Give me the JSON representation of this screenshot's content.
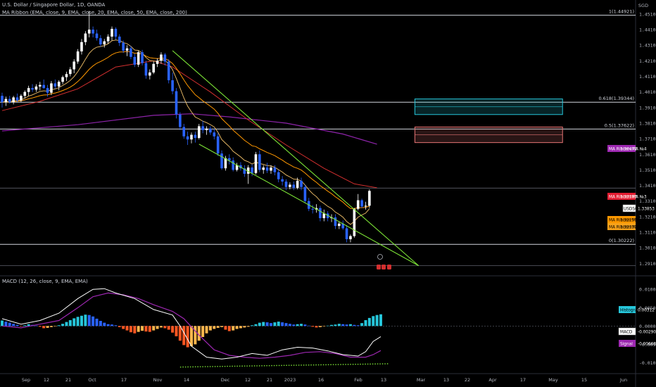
{
  "header": {
    "title": "U.S. Dollar / Singapore Dollar, 1D, OANDA",
    "ma_ribbon": "MA Ribbon (EMA, close, 9, EMA, close, 20, EMA, close, 50, EMA, close, 200)",
    "macd_title": "MACD (12, 26, close, 9, EMA, EMA)"
  },
  "currency_label": "SGD",
  "chart_data": {
    "type": "candlestick",
    "symbol": "USDSGD",
    "price_axis": {
      "ylim": [
        1.282,
        1.459
      ],
      "ticks": [
        1.29,
        1.3,
        1.31,
        1.32,
        1.33,
        1.34,
        1.35,
        1.36,
        1.37,
        1.38,
        1.39,
        1.4,
        1.41,
        1.42,
        1.43,
        1.44,
        1.45
      ],
      "tick_labels": [
        "1.29100",
        "1.30100",
        "1.31100",
        "1.32100",
        "1.33100",
        "1.34100",
        "1.35100",
        "1.36100",
        "1.37100",
        "1.38100",
        "1.39100",
        "1.40100",
        "1.41100",
        "1.42100",
        "1.43100",
        "1.44100",
        "1.45100"
      ]
    },
    "time_axis": {
      "labels": [
        "Sep",
        "12",
        "21",
        "Oct",
        "17",
        "Nov",
        "14",
        "Dec",
        "12",
        "21",
        "2023",
        "16",
        "Feb",
        "13",
        "Mar",
        "13",
        "22",
        "Apr",
        "17",
        "May",
        "15",
        "Jun"
      ]
    },
    "candles": [
      {
        "o": 1.3975,
        "h": 1.3995,
        "l": 1.39,
        "c": 1.3935
      },
      {
        "o": 1.3935,
        "h": 1.397,
        "l": 1.391,
        "c": 1.3955
      },
      {
        "o": 1.3955,
        "h": 1.3975,
        "l": 1.3925,
        "c": 1.3935
      },
      {
        "o": 1.3935,
        "h": 1.3975,
        "l": 1.392,
        "c": 1.3965
      },
      {
        "o": 1.3965,
        "h": 1.399,
        "l": 1.3935,
        "c": 1.3945
      },
      {
        "o": 1.3945,
        "h": 1.3985,
        "l": 1.3935,
        "c": 1.3975
      },
      {
        "o": 1.3975,
        "h": 1.401,
        "l": 1.396,
        "c": 1.4
      },
      {
        "o": 1.4,
        "h": 1.404,
        "l": 1.3975,
        "c": 1.4025
      },
      {
        "o": 1.4025,
        "h": 1.405,
        "l": 1.4,
        "c": 1.4015
      },
      {
        "o": 1.4015,
        "h": 1.405,
        "l": 1.4,
        "c": 1.4035
      },
      {
        "o": 1.4035,
        "h": 1.4065,
        "l": 1.401,
        "c": 1.4045
      },
      {
        "o": 1.4045,
        "h": 1.408,
        "l": 1.402,
        "c": 1.4025
      },
      {
        "o": 1.4025,
        "h": 1.4045,
        "l": 1.397,
        "c": 1.3995
      },
      {
        "o": 1.3995,
        "h": 1.407,
        "l": 1.398,
        "c": 1.4055
      },
      {
        "o": 1.4055,
        "h": 1.408,
        "l": 1.402,
        "c": 1.4035
      },
      {
        "o": 1.4035,
        "h": 1.4075,
        "l": 1.401,
        "c": 1.4065
      },
      {
        "o": 1.4065,
        "h": 1.4105,
        "l": 1.405,
        "c": 1.4095
      },
      {
        "o": 1.4095,
        "h": 1.413,
        "l": 1.407,
        "c": 1.4115
      },
      {
        "o": 1.4115,
        "h": 1.416,
        "l": 1.41,
        "c": 1.4145
      },
      {
        "o": 1.4145,
        "h": 1.421,
        "l": 1.412,
        "c": 1.4195
      },
      {
        "o": 1.4195,
        "h": 1.4275,
        "l": 1.418,
        "c": 1.426
      },
      {
        "o": 1.426,
        "h": 1.434,
        "l": 1.424,
        "c": 1.432
      },
      {
        "o": 1.432,
        "h": 1.439,
        "l": 1.43,
        "c": 1.4375
      },
      {
        "o": 1.4375,
        "h": 1.452,
        "l": 1.435,
        "c": 1.44
      },
      {
        "o": 1.44,
        "h": 1.442,
        "l": 1.435,
        "c": 1.4375
      },
      {
        "o": 1.4375,
        "h": 1.44,
        "l": 1.433,
        "c": 1.4345
      },
      {
        "o": 1.4345,
        "h": 1.4365,
        "l": 1.429,
        "c": 1.4305
      },
      {
        "o": 1.4305,
        "h": 1.434,
        "l": 1.4285,
        "c": 1.4325
      },
      {
        "o": 1.4325,
        "h": 1.437,
        "l": 1.431,
        "c": 1.4355
      },
      {
        "o": 1.4355,
        "h": 1.442,
        "l": 1.433,
        "c": 1.4405
      },
      {
        "o": 1.4405,
        "h": 1.4415,
        "l": 1.4335,
        "c": 1.4355
      },
      {
        "o": 1.4355,
        "h": 1.437,
        "l": 1.4295,
        "c": 1.4315
      },
      {
        "o": 1.4315,
        "h": 1.433,
        "l": 1.425,
        "c": 1.4265
      },
      {
        "o": 1.4265,
        "h": 1.43,
        "l": 1.423,
        "c": 1.428
      },
      {
        "o": 1.428,
        "h": 1.4295,
        "l": 1.421,
        "c": 1.4225
      },
      {
        "o": 1.4225,
        "h": 1.4245,
        "l": 1.416,
        "c": 1.4175
      },
      {
        "o": 1.4175,
        "h": 1.4265,
        "l": 1.416,
        "c": 1.4255
      },
      {
        "o": 1.4255,
        "h": 1.427,
        "l": 1.417,
        "c": 1.4185
      },
      {
        "o": 1.4185,
        "h": 1.42,
        "l": 1.4085,
        "c": 1.4105
      },
      {
        "o": 1.4105,
        "h": 1.4145,
        "l": 1.408,
        "c": 1.4125
      },
      {
        "o": 1.4125,
        "h": 1.4195,
        "l": 1.4115,
        "c": 1.418
      },
      {
        "o": 1.418,
        "h": 1.4215,
        "l": 1.416,
        "c": 1.42
      },
      {
        "o": 1.42,
        "h": 1.4255,
        "l": 1.418,
        "c": 1.424
      },
      {
        "o": 1.424,
        "h": 1.425,
        "l": 1.417,
        "c": 1.4195
      },
      {
        "o": 1.4195,
        "h": 1.421,
        "l": 1.4055,
        "c": 1.4075
      },
      {
        "o": 1.4075,
        "h": 1.4125,
        "l": 1.3985,
        "c": 1.4005
      },
      {
        "o": 1.4005,
        "h": 1.4025,
        "l": 1.383,
        "c": 1.3855
      },
      {
        "o": 1.3855,
        "h": 1.387,
        "l": 1.3755,
        "c": 1.3775
      },
      {
        "o": 1.3775,
        "h": 1.3795,
        "l": 1.37,
        "c": 1.3715
      },
      {
        "o": 1.3715,
        "h": 1.3745,
        "l": 1.366,
        "c": 1.3695
      },
      {
        "o": 1.3695,
        "h": 1.374,
        "l": 1.367,
        "c": 1.3725
      },
      {
        "o": 1.3725,
        "h": 1.3745,
        "l": 1.3675,
        "c": 1.3705
      },
      {
        "o": 1.3705,
        "h": 1.3795,
        "l": 1.3695,
        "c": 1.378
      },
      {
        "o": 1.378,
        "h": 1.3815,
        "l": 1.3735,
        "c": 1.3755
      },
      {
        "o": 1.3755,
        "h": 1.378,
        "l": 1.3725,
        "c": 1.3765
      },
      {
        "o": 1.3765,
        "h": 1.378,
        "l": 1.3725,
        "c": 1.374
      },
      {
        "o": 1.374,
        "h": 1.3765,
        "l": 1.3695,
        "c": 1.3715
      },
      {
        "o": 1.3715,
        "h": 1.3735,
        "l": 1.359,
        "c": 1.3605
      },
      {
        "o": 1.3605,
        "h": 1.3625,
        "l": 1.35,
        "c": 1.351
      },
      {
        "o": 1.351,
        "h": 1.359,
        "l": 1.3495,
        "c": 1.3575
      },
      {
        "o": 1.3575,
        "h": 1.36,
        "l": 1.3535,
        "c": 1.356
      },
      {
        "o": 1.356,
        "h": 1.358,
        "l": 1.349,
        "c": 1.35
      },
      {
        "o": 1.35,
        "h": 1.3545,
        "l": 1.349,
        "c": 1.353
      },
      {
        "o": 1.353,
        "h": 1.355,
        "l": 1.3495,
        "c": 1.351
      },
      {
        "o": 1.351,
        "h": 1.353,
        "l": 1.3455,
        "c": 1.3475
      },
      {
        "o": 1.3475,
        "h": 1.353,
        "l": 1.341,
        "c": 1.3515
      },
      {
        "o": 1.3515,
        "h": 1.3535,
        "l": 1.346,
        "c": 1.348
      },
      {
        "o": 1.348,
        "h": 1.3615,
        "l": 1.347,
        "c": 1.36
      },
      {
        "o": 1.36,
        "h": 1.3625,
        "l": 1.3485,
        "c": 1.35
      },
      {
        "o": 1.35,
        "h": 1.353,
        "l": 1.3475,
        "c": 1.3515
      },
      {
        "o": 1.3515,
        "h": 1.3545,
        "l": 1.348,
        "c": 1.3495
      },
      {
        "o": 1.3495,
        "h": 1.353,
        "l": 1.3475,
        "c": 1.3515
      },
      {
        "o": 1.3515,
        "h": 1.353,
        "l": 1.3465,
        "c": 1.3485
      },
      {
        "o": 1.3485,
        "h": 1.35,
        "l": 1.342,
        "c": 1.344
      },
      {
        "o": 1.344,
        "h": 1.346,
        "l": 1.34,
        "c": 1.3425
      },
      {
        "o": 1.3425,
        "h": 1.344,
        "l": 1.337,
        "c": 1.339
      },
      {
        "o": 1.339,
        "h": 1.342,
        "l": 1.3375,
        "c": 1.3405
      },
      {
        "o": 1.3405,
        "h": 1.3425,
        "l": 1.337,
        "c": 1.3385
      },
      {
        "o": 1.3385,
        "h": 1.345,
        "l": 1.3375,
        "c": 1.343
      },
      {
        "o": 1.343,
        "h": 1.345,
        "l": 1.337,
        "c": 1.339
      },
      {
        "o": 1.339,
        "h": 1.3405,
        "l": 1.329,
        "c": 1.33
      },
      {
        "o": 1.33,
        "h": 1.332,
        "l": 1.3235,
        "c": 1.325
      },
      {
        "o": 1.325,
        "h": 1.3275,
        "l": 1.322,
        "c": 1.3245
      },
      {
        "o": 1.3245,
        "h": 1.328,
        "l": 1.3225,
        "c": 1.3255
      },
      {
        "o": 1.3255,
        "h": 1.327,
        "l": 1.317,
        "c": 1.319
      },
      {
        "o": 1.319,
        "h": 1.3245,
        "l": 1.317,
        "c": 1.322
      },
      {
        "o": 1.322,
        "h": 1.3235,
        "l": 1.317,
        "c": 1.319
      },
      {
        "o": 1.319,
        "h": 1.3215,
        "l": 1.3165,
        "c": 1.3195
      },
      {
        "o": 1.3195,
        "h": 1.3215,
        "l": 1.312,
        "c": 1.314
      },
      {
        "o": 1.314,
        "h": 1.317,
        "l": 1.312,
        "c": 1.3155
      },
      {
        "o": 1.3155,
        "h": 1.3175,
        "l": 1.3115,
        "c": 1.3125
      },
      {
        "o": 1.3125,
        "h": 1.3145,
        "l": 1.3035,
        "c": 1.3055
      },
      {
        "o": 1.3055,
        "h": 1.3085,
        "l": 1.3035,
        "c": 1.3075
      },
      {
        "o": 1.3075,
        "h": 1.3255,
        "l": 1.3065,
        "c": 1.325
      },
      {
        "o": 1.325,
        "h": 1.3345,
        "l": 1.324,
        "c": 1.3305
      },
      {
        "o": 1.3305,
        "h": 1.3315,
        "l": 1.3255,
        "c": 1.3265
      },
      {
        "o": 1.3265,
        "h": 1.3295,
        "l": 1.3245,
        "c": 1.327
      },
      {
        "o": 1.327,
        "h": 1.3375,
        "l": 1.3255,
        "c": 1.3365
      }
    ],
    "ma_ribbon": {
      "series": [
        {
          "name": "MA Ribbon:MA №1",
          "color": "#f7a21b",
          "value_label": "1.32332"
        },
        {
          "name": "MA Ribbon:MA №2",
          "color": "#ff9800",
          "value_label": "1.32259"
        },
        {
          "name": "MA Ribbon:MA №3",
          "color": "#e31c31",
          "value_label": "1.33383"
        },
        {
          "name": "MA Ribbon:MA №4",
          "color": "#9c27b0",
          "value_label": "1.36472"
        }
      ],
      "ema200_points": [
        [
          0,
          1.375
        ],
        [
          20,
          1.379
        ],
        [
          40,
          1.385
        ],
        [
          50,
          1.386
        ],
        [
          60,
          1.384
        ],
        [
          75,
          1.38
        ],
        [
          90,
          1.373
        ],
        [
          99,
          1.3665
        ]
      ],
      "ema50_points": [
        [
          0,
          1.388
        ],
        [
          10,
          1.394
        ],
        [
          20,
          1.402
        ],
        [
          30,
          1.416
        ],
        [
          40,
          1.42
        ],
        [
          45,
          1.416
        ],
        [
          55,
          1.4
        ],
        [
          65,
          1.382
        ],
        [
          75,
          1.366
        ],
        [
          85,
          1.351
        ],
        [
          93,
          1.341
        ],
        [
          99,
          1.3385
        ]
      ]
    },
    "price_label": {
      "name": "USDSGD",
      "value": "1.33853"
    },
    "top_label": "1(1.44921)",
    "fib_levels": [
      {
        "label": "1(1.44921)",
        "value": 1.44921
      },
      {
        "label": "0.618(1.39344)",
        "value": 1.39344
      },
      {
        "label": "0.5(1.37622)",
        "value": 1.37622
      },
      {
        "label": "0(1.30222)",
        "value": 1.30222
      }
    ],
    "extra_levels": [
      1.3383,
      1.2885
    ],
    "zones": [
      {
        "name": "cyan-zone",
        "top": 1.3955,
        "bottom": 1.3855,
        "start_bar": 109,
        "end_bar": 148,
        "color": "#26c6da"
      },
      {
        "name": "red-zone",
        "top": 1.3775,
        "bottom": 1.3675,
        "start_bar": 109,
        "end_bar": 148,
        "color": "#e57373"
      }
    ],
    "trendlines": [
      {
        "name": "upper-wedge-line",
        "from": [
          45,
          1.4265
        ],
        "to": [
          110,
          1.2885
        ],
        "color": "#7ce336"
      },
      {
        "name": "lower-wedge-line",
        "from": [
          52,
          1.3665
        ],
        "to": [
          110,
          1.2885
        ],
        "color": "#7ce336"
      }
    ],
    "macd": {
      "ylim": [
        -0.0128,
        0.0135
      ],
      "ticks": [
        0.01,
        0.005,
        0.0,
        -0.005,
        -0.01
      ],
      "tick_labels": [
        "0.01000",
        "0.00500",
        "0.00000",
        "-0.00500",
        "-0.01000"
      ],
      "histogram_label": "Histogram",
      "histogram_value": "0.00312",
      "macd_label": "MACD",
      "macd_value": "-0.00290",
      "signal_label": "Signal",
      "signal_value": "-0.00668",
      "histogram": [
        0.0015,
        0.0012,
        0.0009,
        0.0006,
        0.0003,
        -0.0001,
        0.0002,
        0.0005,
        0.0003,
        0.0001,
        -0.0002,
        -0.0006,
        -0.0005,
        -0.0003,
        -0.0001,
        0.0002,
        0.0006,
        0.0011,
        0.0016,
        0.0021,
        0.0025,
        0.0028,
        0.0031,
        0.003,
        0.0026,
        0.002,
        0.0014,
        0.0009,
        0.0005,
        0.0004,
        0.0002,
        -0.0003,
        -0.0008,
        -0.0012,
        -0.0017,
        -0.002,
        -0.0016,
        -0.0013,
        -0.0015,
        -0.0016,
        -0.0012,
        -0.0008,
        -0.0004,
        -0.0006,
        -0.001,
        -0.0018,
        -0.0028,
        -0.004,
        -0.0052,
        -0.0058,
        -0.0055,
        -0.005,
        -0.004,
        -0.003,
        -0.002,
        -0.0012,
        -0.0008,
        -0.0005,
        -0.0003,
        -0.001,
        -0.0014,
        -0.0012,
        -0.0008,
        -0.0006,
        -0.0004,
        -0.0002,
        0.0002,
        0.0005,
        0.0009,
        0.0011,
        0.001,
        0.0008,
        0.001,
        0.0012,
        0.001,
        0.0008,
        0.0006,
        0.0004,
        0.0005,
        0.0006,
        0.0004,
        0.0001,
        -0.0002,
        -0.0004,
        -0.0003,
        -0.0001,
        0.0001,
        0.0003,
        0.0004,
        0.0006,
        0.0005,
        0.0004,
        0.0005,
        0.0003,
        0.0002,
        0.0008,
        0.0016,
        0.0022,
        0.0027,
        0.003,
        0.0032
      ],
      "macd_line_points": [
        [
          0,
          0.002
        ],
        [
          5,
          0.0005
        ],
        [
          10,
          0.0015
        ],
        [
          15,
          0.0035
        ],
        [
          20,
          0.0075
        ],
        [
          24,
          0.01
        ],
        [
          27,
          0.0102
        ],
        [
          30,
          0.009
        ],
        [
          35,
          0.0075
        ],
        [
          40,
          0.0045
        ],
        [
          45,
          0.003
        ],
        [
          47,
          0.0
        ],
        [
          50,
          -0.0055
        ],
        [
          54,
          -0.0085
        ],
        [
          58,
          -0.009
        ],
        [
          62,
          -0.0085
        ],
        [
          66,
          -0.0075
        ],
        [
          70,
          -0.008
        ],
        [
          74,
          -0.0065
        ],
        [
          78,
          -0.0058
        ],
        [
          82,
          -0.006
        ],
        [
          86,
          -0.0068
        ],
        [
          90,
          -0.0078
        ],
        [
          94,
          -0.0082
        ],
        [
          96,
          -0.007
        ],
        [
          98,
          -0.0042
        ],
        [
          100,
          -0.0029
        ]
      ],
      "signal_line_points": [
        [
          0,
          0.0
        ],
        [
          5,
          -0.0005
        ],
        [
          10,
          0.0005
        ],
        [
          15,
          0.0015
        ],
        [
          20,
          0.005
        ],
        [
          24,
          0.008
        ],
        [
          28,
          0.009
        ],
        [
          32,
          0.0085
        ],
        [
          36,
          0.0075
        ],
        [
          40,
          0.0058
        ],
        [
          45,
          0.004
        ],
        [
          48,
          0.002
        ],
        [
          52,
          -0.0025
        ],
        [
          56,
          -0.0065
        ],
        [
          60,
          -0.008
        ],
        [
          64,
          -0.0085
        ],
        [
          68,
          -0.0088
        ],
        [
          72,
          -0.0085
        ],
        [
          76,
          -0.008
        ],
        [
          80,
          -0.0072
        ],
        [
          84,
          -0.007
        ],
        [
          88,
          -0.0075
        ],
        [
          92,
          -0.0085
        ],
        [
          96,
          -0.0085
        ],
        [
          98,
          -0.0078
        ],
        [
          100,
          -0.0067
        ]
      ],
      "trendline": {
        "from": [
          47,
          -0.0112
        ],
        "to": [
          102,
          -0.0103
        ],
        "color": "#7ce336"
      }
    }
  }
}
